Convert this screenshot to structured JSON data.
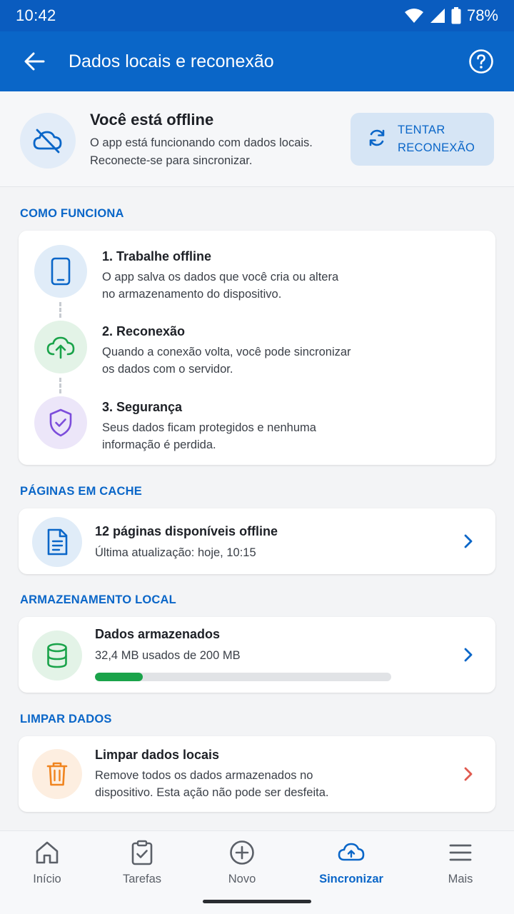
{
  "status_bar": {
    "time": "10:42",
    "battery": "78%"
  },
  "app_bar": {
    "title": "Dados locais e reconexão",
    "back_icon": "arrow-left-icon",
    "help_icon": "help-circle-icon"
  },
  "offline": {
    "title": "Você está offline",
    "desc_line1": "O app está funcionando com dados locais.",
    "desc_line2": "Reconecte-se para sincronizar.",
    "retry_line1": "TENTAR",
    "retry_line2": "RECONEXÃO"
  },
  "how_it_works": {
    "section": "COMO FUNCIONA",
    "steps": [
      {
        "title": "1. Trabalhe offline",
        "line1": "O app salva os dados que você cria ou altera",
        "line2": "no armazenamento do dispositivo.",
        "icon": "smartphone-icon"
      },
      {
        "title": "2. Reconexão",
        "line1": "Quando a conexão volta, você pode sincronizar",
        "line2": "os dados com o servidor.",
        "icon": "cloud-upload-icon"
      },
      {
        "title": "3. Segurança",
        "line1": "Seus dados ficam protegidos e nenhuma",
        "line2": "informação é perdida.",
        "icon": "shield-check-icon"
      }
    ]
  },
  "cache": {
    "section": "PÁGINAS EM CACHE",
    "title": "12 páginas disponíveis offline",
    "subtitle": "Última atualização: hoje, 10:15"
  },
  "storage": {
    "section": "ARMAZENAMENTO LOCAL",
    "title": "Dados armazenados",
    "subtitle": "32,4 MB usados de 200 MB",
    "used_mb": 32.4,
    "total_mb": 200
  },
  "clear": {
    "section": "LIMPAR DADOS",
    "title": "Limpar dados locais",
    "line1": "Remove todos os dados armazenados no",
    "line2": "dispositivo. Esta ação não pode ser desfeita."
  },
  "nav": [
    {
      "label": "Início",
      "icon": "home-icon"
    },
    {
      "label": "Tarefas",
      "icon": "clipboard-check-icon"
    },
    {
      "label": "Novo",
      "icon": "plus-circle-icon"
    },
    {
      "label": "Sincronizar",
      "icon": "cloud-upload-icon",
      "active": true
    },
    {
      "label": "Mais",
      "icon": "menu-icon"
    }
  ],
  "colors": {
    "primary": "#0a66c8",
    "success": "#1aa34a",
    "danger": "#e05a4f",
    "warning": "#f0841f",
    "purple": "#7c4ddb"
  }
}
